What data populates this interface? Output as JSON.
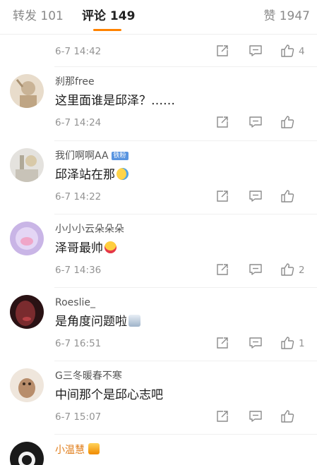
{
  "tabs": {
    "repost": "转发 101",
    "comment": "评论 149",
    "like": "赞 1947"
  },
  "top_row": {
    "time": "6-7 14:42",
    "like_count": "4"
  },
  "comments": [
    {
      "name": "刹那free",
      "text": "这里面谁是邱泽？……",
      "time": "6-7 14:24",
      "like_count": ""
    },
    {
      "name": "我们啊啊AA",
      "badge": "铁粉",
      "text": "邱泽站在那",
      "emoji": "laughing-tears-emoji",
      "time": "6-7 14:22",
      "like_count": ""
    },
    {
      "name": "小小小云朵朵朵",
      "text": "泽哥最帅",
      "emoji": "heart-eyes-emoji",
      "time": "6-7 14:36",
      "like_count": "2"
    },
    {
      "name": "Roeslie_",
      "text": "是角度问题啦",
      "emoji": "sticker-emoji",
      "time": "6-7 16:51",
      "like_count": "1"
    },
    {
      "name": "G三冬暖春不寒",
      "text": "中间那个是邱心志吧",
      "time": "6-7 15:07",
      "like_count": ""
    },
    {
      "name": "小温慧",
      "emoji": "crown-emoji",
      "text": "",
      "time": "",
      "like_count": ""
    }
  ],
  "colors": {
    "accent": "#ff8200",
    "tab_inactive": "#8a8a8a",
    "meta": "#939393",
    "badge": "#5a95e0",
    "gold_name": "#e07d1a"
  },
  "icons": [
    "share-icon",
    "reply-icon",
    "like-icon"
  ]
}
